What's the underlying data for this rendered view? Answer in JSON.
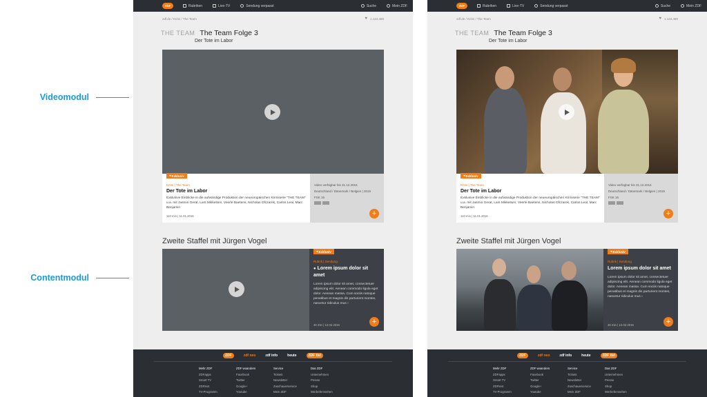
{
  "annotations": {
    "video": "Videomodul",
    "content": "Contentmodul"
  },
  "nav": {
    "logo": "ZDF",
    "rubriken": "Rubriken",
    "livetv": "Live-TV",
    "missed": "Sendung verpasst",
    "search": "Suche",
    "account": "Mein ZDF"
  },
  "breadcrumb": "zdf.de / Krimi / The Team",
  "likes": "1.134.480",
  "brandmark": "THE TEAM",
  "episode_title": "The Team Folge 3",
  "subtitle": "Der Tote im Labor",
  "video_info": {
    "badge": "Exklusiv",
    "kicker": "Krimi | The Team",
    "title": "Der Tote im Labor",
    "description": "Exklusive Einblicke in die aufwändige Produktion der neueuropäischen Krimiserie \"THE TEAM\" u.a. mit Jasmin Gerat, Lars Mikkelsen, Veerle Baetens, Nicholas Ofczarek, Carlos Leal, Marc Benjamin",
    "meta": "110 min | 11.01.2016",
    "available": "Video verfügbar bis 31.12.2016",
    "countries": "Deutschland / Dänemark / Belgien | 2015",
    "rating": "FSK 16"
  },
  "section_title": "Zweite Staffel mit Jürgen Vogel",
  "content_info": {
    "badge": "Exklusiv",
    "kicker": "Rubrik | Sendung",
    "title": "Lorem ipsum dolor sit amet",
    "description": "Lorem ipsum dolor sit amet, consectetuer adipiscing elit. Aenean commodo ligula eget dolor. Aenean massa. Cum sociis natoque penatibus et magnis dis parturient montes, nascetur ridiculus mus",
    "more": "›",
    "meta": "46 min | 12.02.2016"
  },
  "footer": {
    "brands": [
      "ZDF",
      "zdf neo",
      "zdf info",
      "heute",
      "ZDF tivi"
    ],
    "columns": [
      {
        "head": "Mehr ZDF",
        "items": [
          "ZDFapps",
          "Smart TV",
          "ZDFtext",
          "TV-Programm"
        ]
      },
      {
        "head": "ZDF woanders",
        "items": [
          "Facebook",
          "Twitter",
          "Google+",
          "Youtube"
        ]
      },
      {
        "head": "Service",
        "items": [
          "Tickets",
          "Newsletter",
          "Zuschauerservice",
          "Mein ZDF"
        ]
      },
      {
        "head": "Das ZDF",
        "items": [
          "Unternehmen",
          "Presse",
          "Shop",
          "Werbefernsehen"
        ]
      }
    ]
  },
  "colors": {
    "accent": "#f07d19",
    "annotation": "#1a9bd7",
    "nav": "#2b2e33",
    "placeholder": "#5b6064"
  }
}
